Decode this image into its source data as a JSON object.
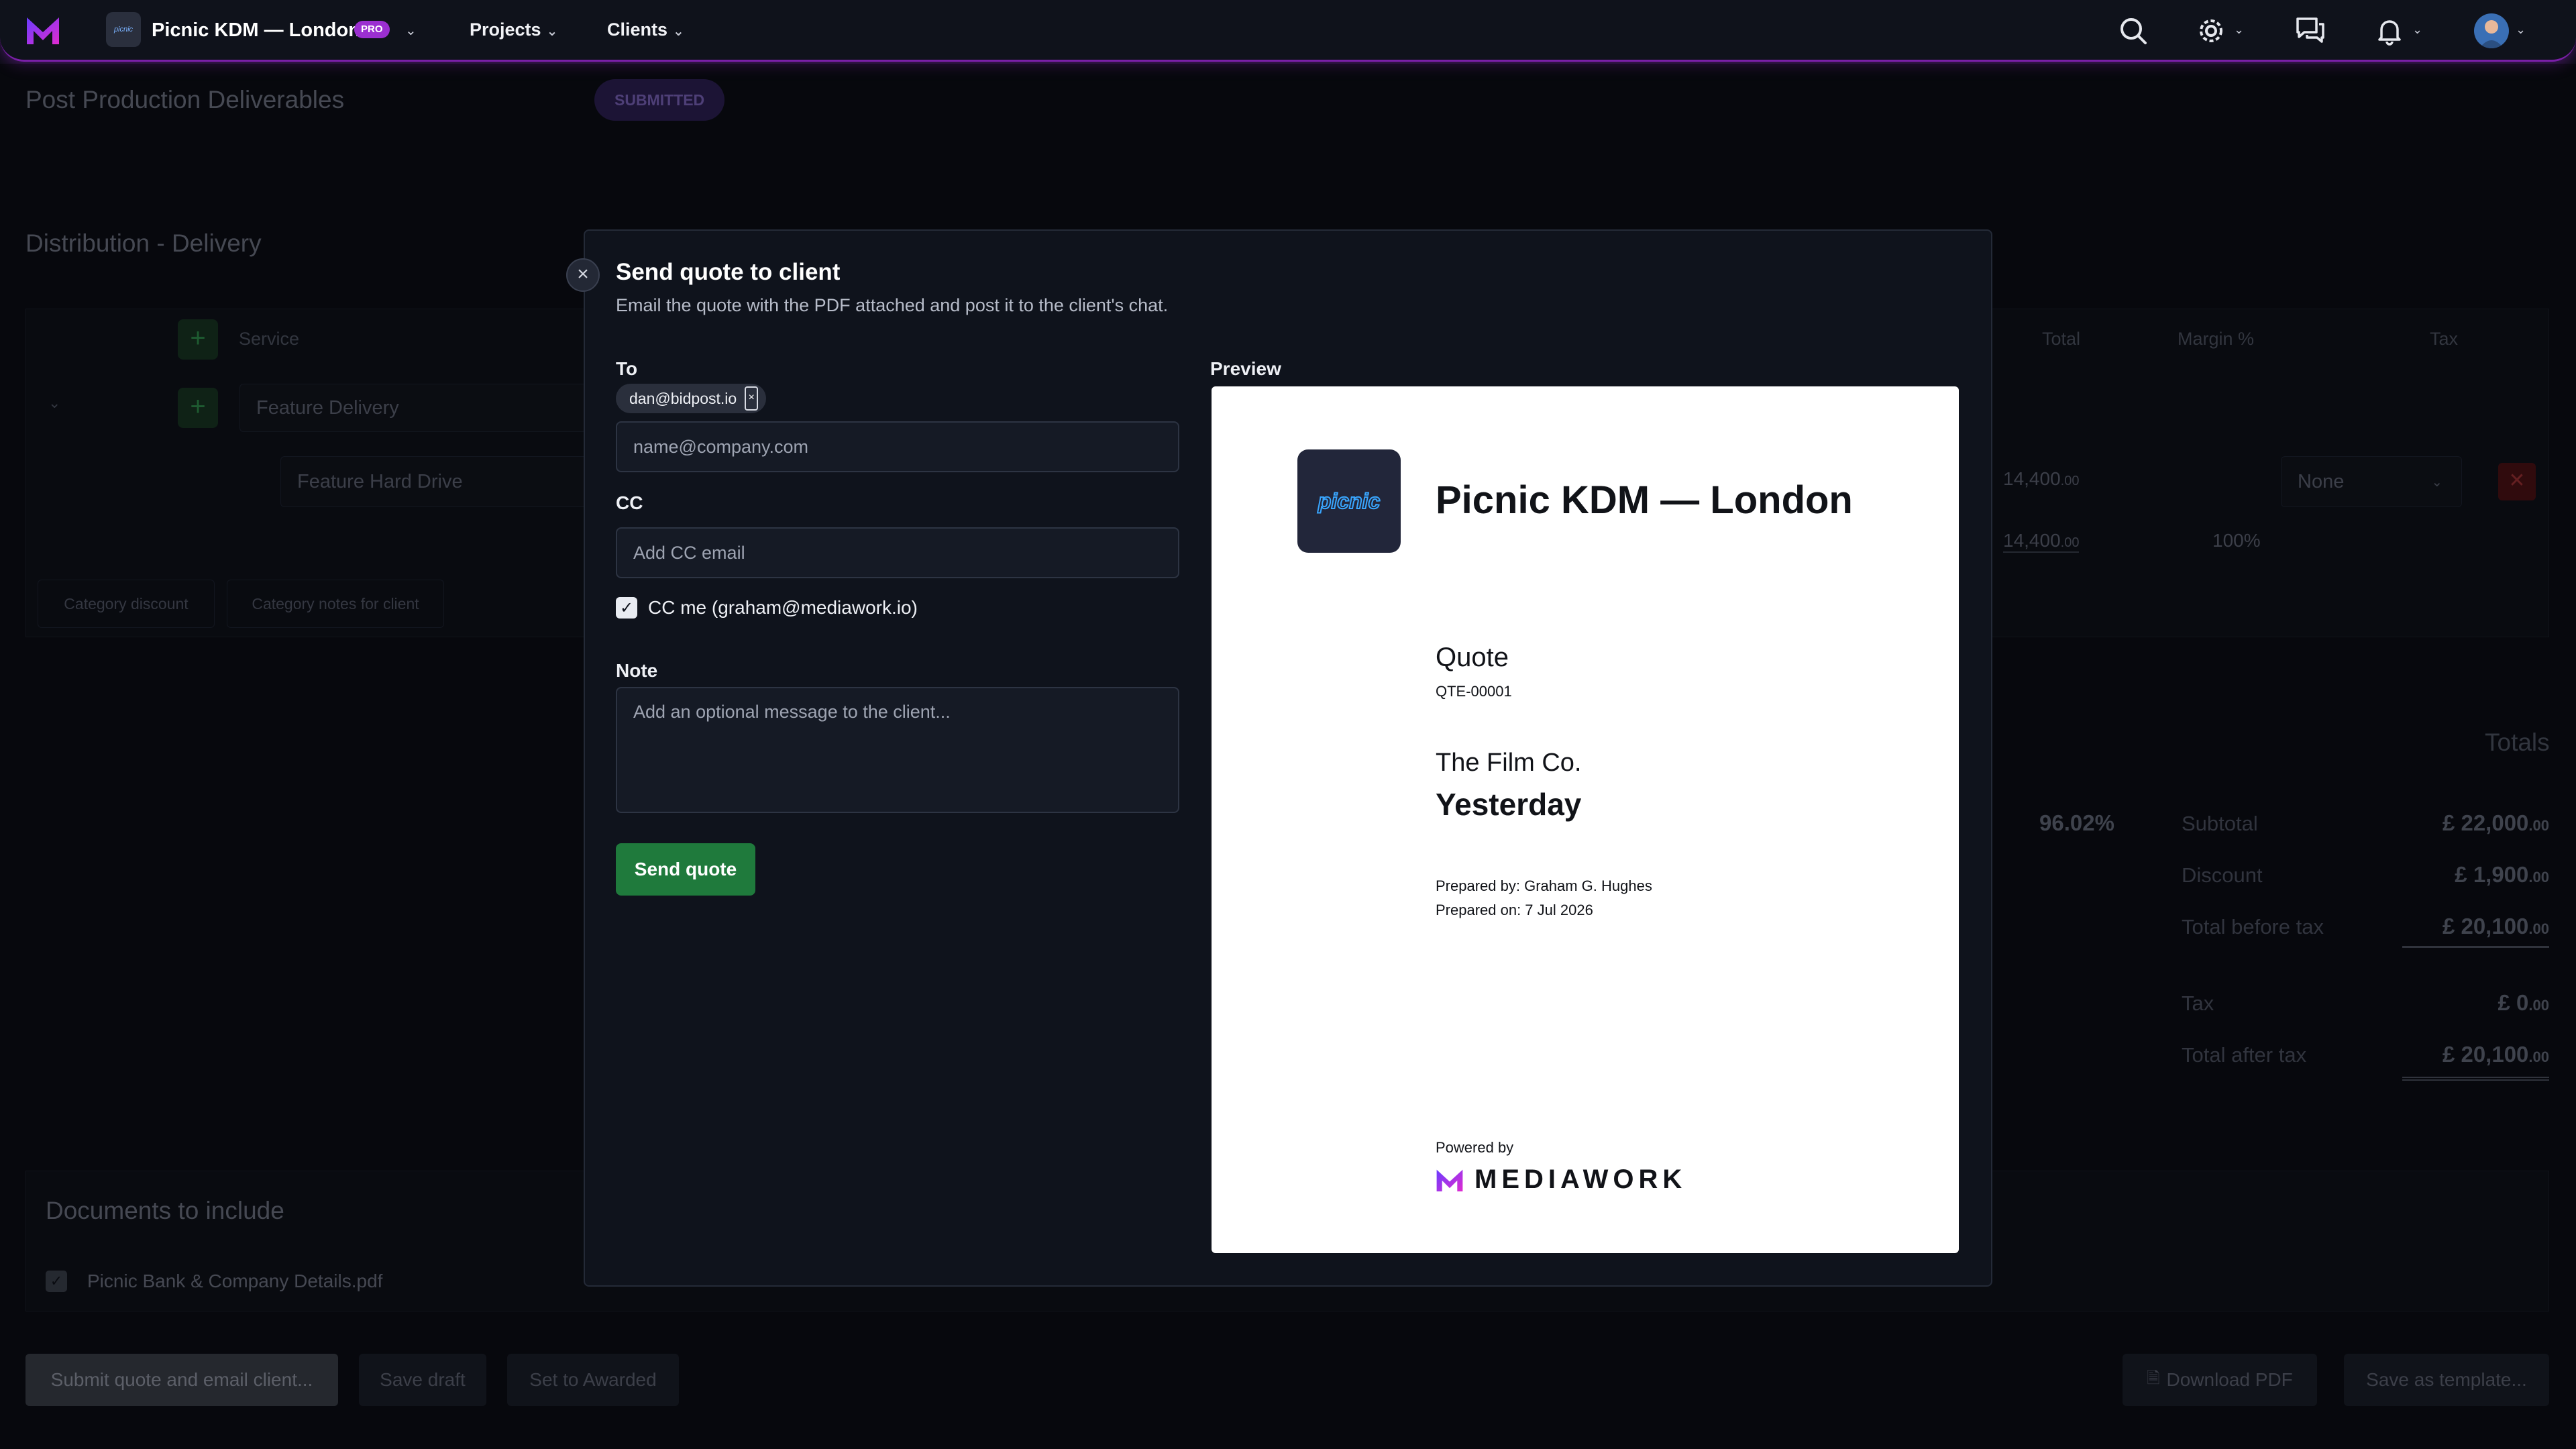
{
  "topbar": {
    "workspace_thumb": "picnic",
    "workspace_name": "Picnic KDM — London",
    "plan_badge": "PRO",
    "nav": [
      {
        "label": "Projects"
      },
      {
        "label": "Clients"
      }
    ],
    "icons": [
      "search-icon",
      "gear-icon",
      "chat-icon",
      "bell-icon",
      "avatar"
    ],
    "accent": "#9b2fd0"
  },
  "page": {
    "section1_title": "Post Production Deliverables",
    "status": "SUBMITTED",
    "section2_title": "Distribution - Delivery",
    "table_headers": {
      "service": "Service",
      "total": "Total",
      "margin": "Margin %",
      "tax": "Tax"
    },
    "row_category": "Feature Delivery",
    "row_item": "Feature Hard Drive",
    "row_item_total": "14,400",
    "row_item_total_decimals": ".00",
    "row_item_tax": "None",
    "subtotal_total": "14,400",
    "subtotal_total_decimals": ".00",
    "subtotal_margin": "100%",
    "category_discount_btn": "Category discount",
    "category_notes_btn": "Category notes for client",
    "totals_title": "Totals",
    "overall_margin": "96.02%",
    "totals": [
      {
        "label": "Subtotal",
        "currency": "£",
        "value": "22,000",
        "decimals": ".00"
      },
      {
        "label": "Discount",
        "currency": "£",
        "value": "1,900",
        "decimals": ".00"
      },
      {
        "label": "Total before tax",
        "currency": "£",
        "value": "20,100",
        "decimals": ".00"
      },
      {
        "label": "Tax",
        "currency": "£",
        "value": "0",
        "decimals": ".00"
      },
      {
        "label": "Total after tax",
        "currency": "£",
        "value": "20,100",
        "decimals": ".00"
      }
    ],
    "documents_title": "Documents to include",
    "document_file": "Picnic Bank & Company Details.pdf",
    "footer": {
      "submit": "Submit quote and email client...",
      "save_draft": "Save draft",
      "set_awarded": "Set to Awarded",
      "download_pdf": "Download PDF",
      "save_template": "Save as template..."
    }
  },
  "modal": {
    "title": "Send quote to client",
    "subtitle": "Email the quote with the PDF attached and post it to the client's chat.",
    "to_label": "To",
    "to_chip": "dan@bidpost.io",
    "to_placeholder": "name@company.com",
    "cc_label": "CC",
    "cc_placeholder": "Add CC email",
    "cc_me_label": "CC me (graham@mediawork.io)",
    "cc_me_checked": true,
    "note_label": "Note",
    "note_placeholder": "Add an optional message to the client...",
    "send_button": "Send quote",
    "preview_label": "Preview",
    "preview": {
      "logo_text": "picnic",
      "company": "Picnic KDM — London",
      "doc_type": "Quote",
      "doc_number": "QTE-00001",
      "client": "The Film Co.",
      "when": "Yesterday",
      "prepared_by": "Prepared by: Graham G. Hughes",
      "prepared_on": "Prepared on: 7 Jul 2026",
      "powered_by": "Powered by",
      "brand": "MEDIAWORK"
    }
  }
}
